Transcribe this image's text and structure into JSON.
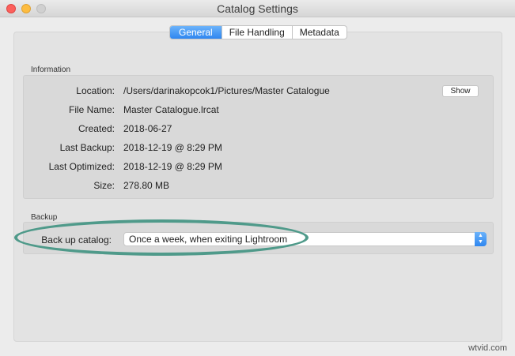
{
  "window": {
    "title": "Catalog Settings"
  },
  "tabs": [
    {
      "label": "General"
    },
    {
      "label": "File Handling"
    },
    {
      "label": "Metadata"
    }
  ],
  "information": {
    "section_label": "Information",
    "rows": [
      {
        "label": "Location:",
        "value": "/Users/darinakopcok1/Pictures/Master Catalogue"
      },
      {
        "label": "File Name:",
        "value": "Master Catalogue.lrcat"
      },
      {
        "label": "Created:",
        "value": "2018-06-27"
      },
      {
        "label": "Last Backup:",
        "value": "2018-12-19 @ 8:29 PM"
      },
      {
        "label": "Last Optimized:",
        "value": "2018-12-19 @ 8:29 PM"
      },
      {
        "label": "Size:",
        "value": "278.80 MB"
      }
    ],
    "show_button": "Show"
  },
  "backup": {
    "section_label": "Backup",
    "label": "Back up catalog:",
    "selected": "Once a week, when exiting Lightroom"
  },
  "watermark": "wtvid.com",
  "colors": {
    "accent": "#2e86f0",
    "highlight_ring": "#4f9a8a"
  }
}
